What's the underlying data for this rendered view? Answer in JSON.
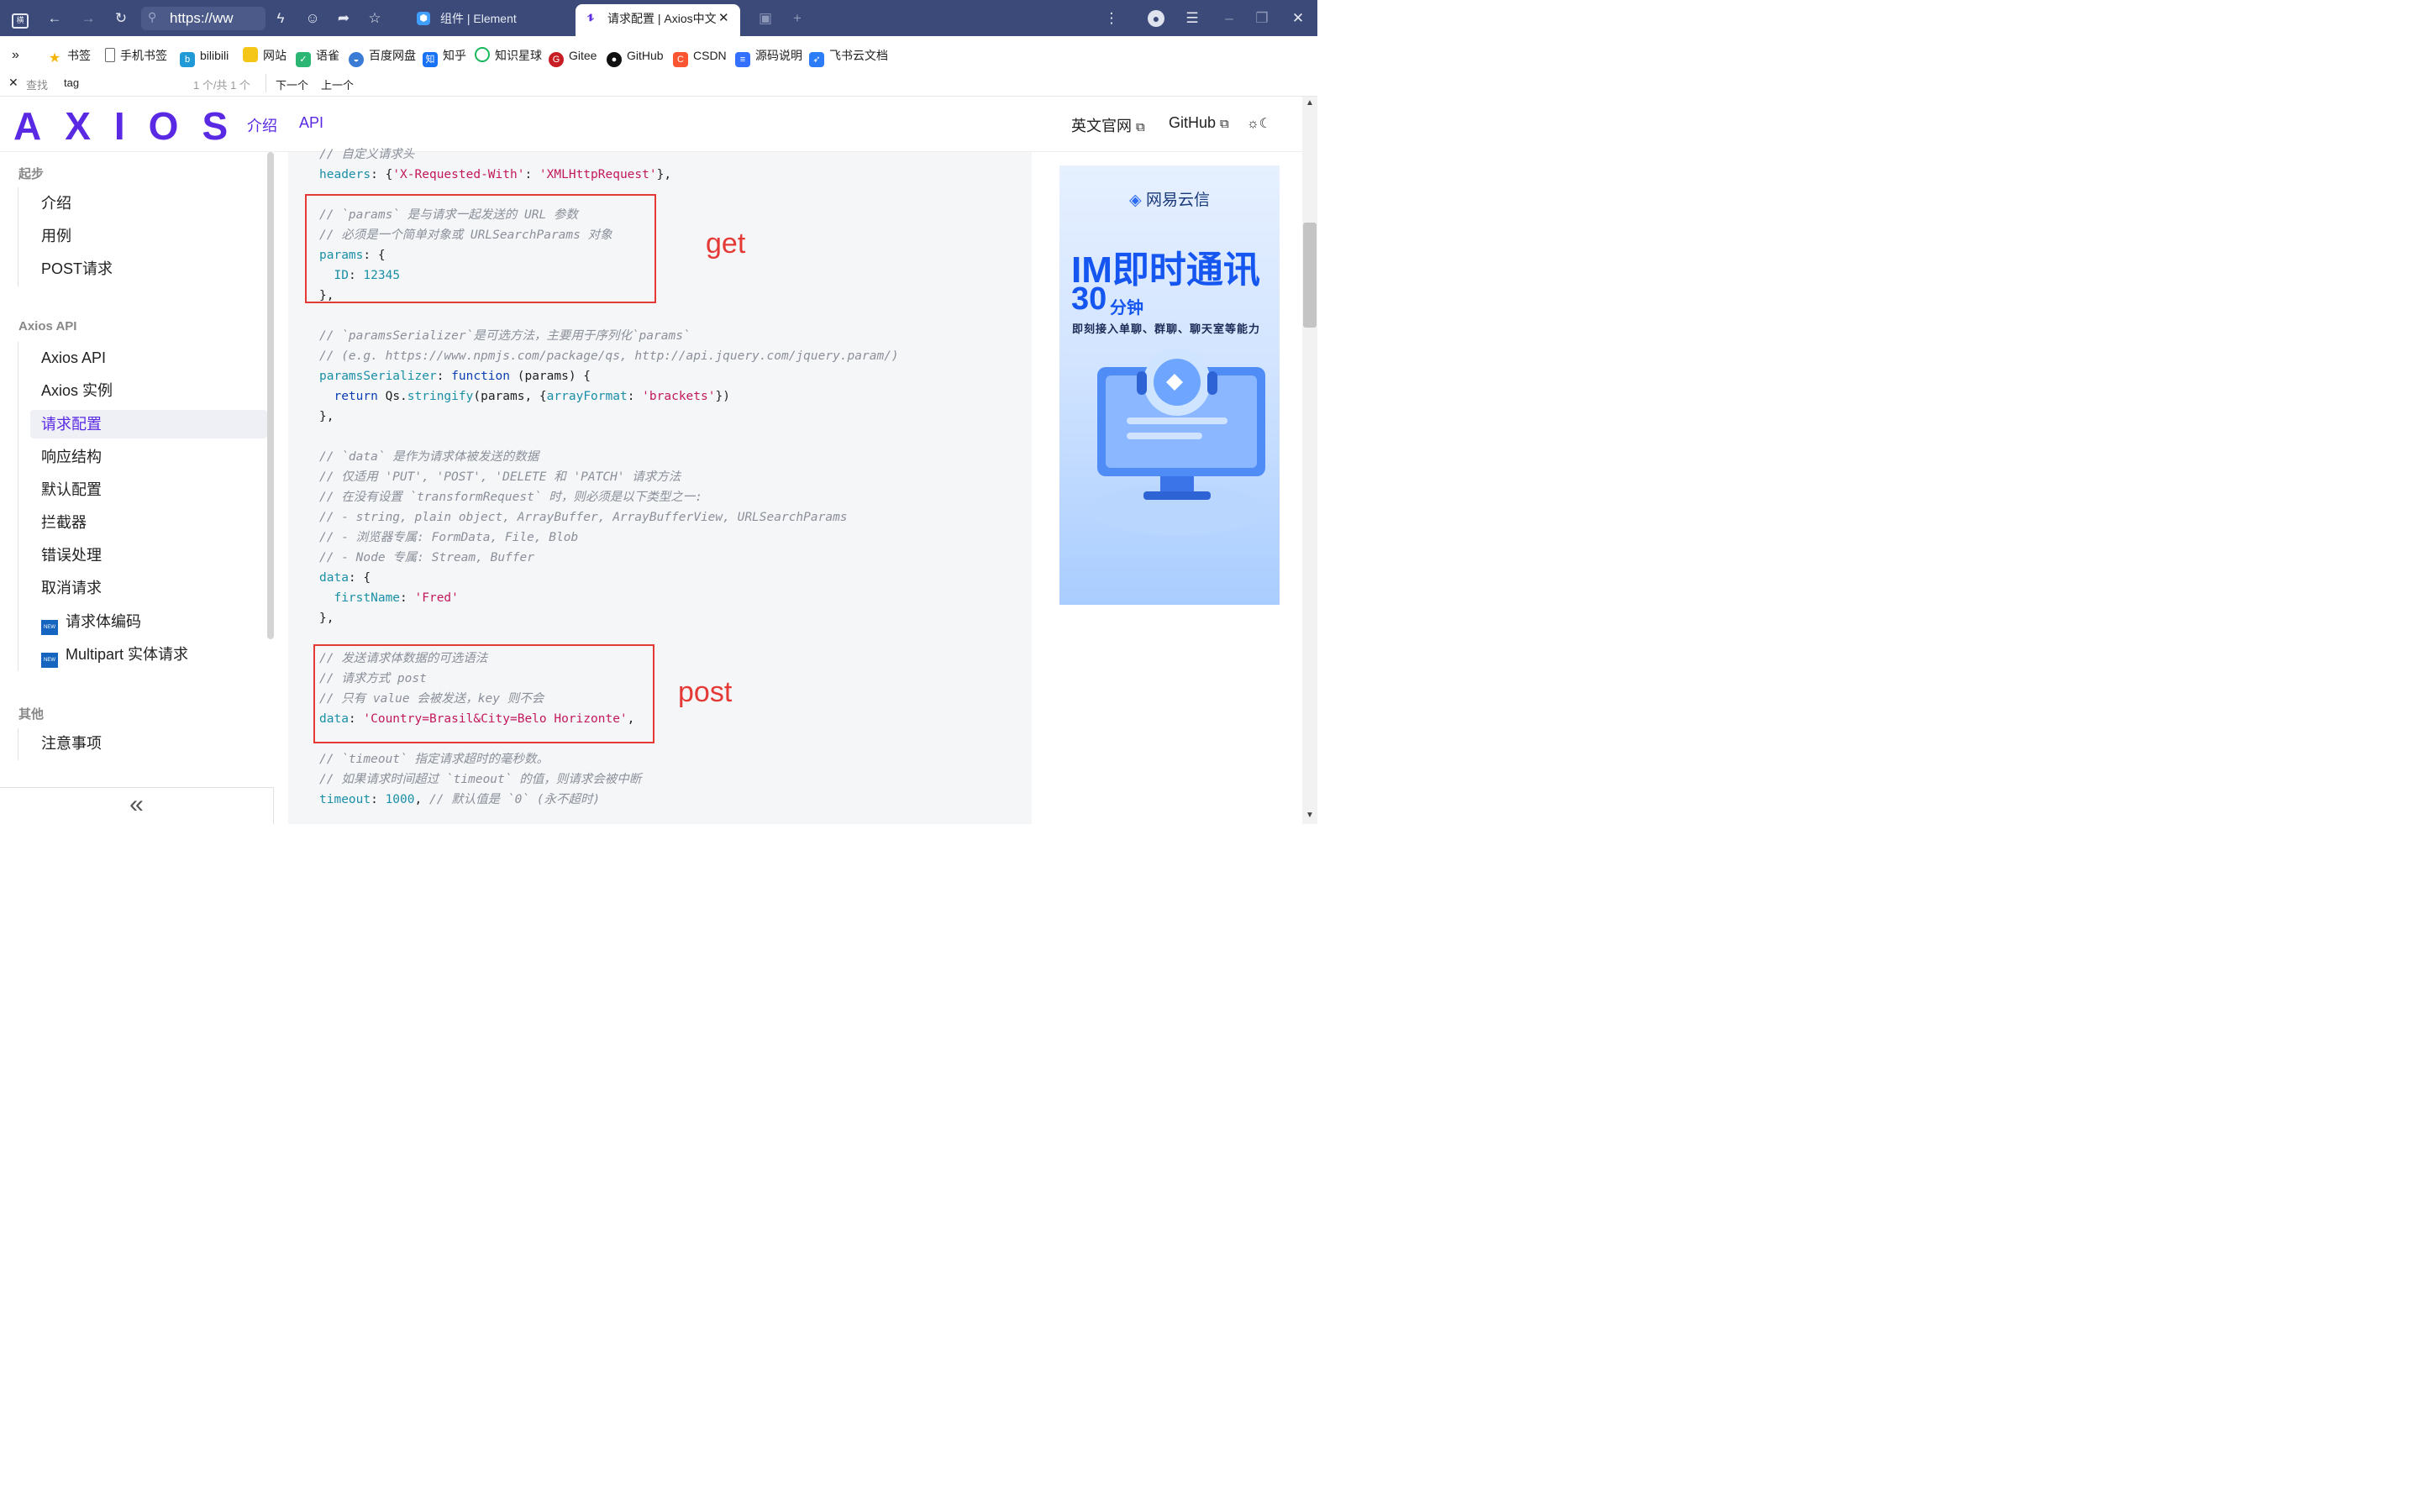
{
  "browser": {
    "address": "https://ww",
    "tabs": [
      {
        "title": "组件 | Element",
        "active": false
      },
      {
        "title": "请求配置 | Axios中文",
        "active": true
      }
    ]
  },
  "bookmarks": [
    {
      "label": "书签",
      "icon": "star-icon",
      "color": "#f5b400"
    },
    {
      "label": "手机书签",
      "icon": "phone-icon",
      "color": "#666666"
    },
    {
      "label": "bilibili",
      "icon": "bilibili-icon",
      "color": "#1f9ad6"
    },
    {
      "label": "网站",
      "icon": "folder-icon",
      "color": "#f5c518"
    },
    {
      "label": "语雀",
      "icon": "yuque-icon",
      "color": "#2bb673"
    },
    {
      "label": "百度网盘",
      "icon": "baidu-pan-icon",
      "color": "#3a7bd5"
    },
    {
      "label": "知乎",
      "icon": "zhihu-icon",
      "color": "#1772f6"
    },
    {
      "label": "知识星球",
      "icon": "planet-icon",
      "color": "#18b95c"
    },
    {
      "label": "Gitee",
      "icon": "gitee-icon",
      "color": "#c71d23"
    },
    {
      "label": "GitHub",
      "icon": "github-icon",
      "color": "#111111"
    },
    {
      "label": "CSDN",
      "icon": "csdn-icon",
      "color": "#fc5531"
    },
    {
      "label": "源码说明",
      "icon": "doc-icon",
      "color": "#3370ff"
    },
    {
      "label": "飞书云文档",
      "icon": "feishu-icon",
      "color": "#2b7cf6"
    }
  ],
  "findbar": {
    "label": "查找",
    "query": "tag",
    "count": "1 个/共 1 个",
    "next": "下一个",
    "prev": "上一个"
  },
  "header": {
    "logo": "AXIOS",
    "nav": [
      "介绍",
      "API"
    ],
    "english_site": "英文官网",
    "github": "GitHub"
  },
  "sidebar": {
    "sections": [
      {
        "title": "起步",
        "items": [
          "介绍",
          "用例",
          "POST请求"
        ]
      },
      {
        "title": "Axios API",
        "items": [
          "Axios API",
          "Axios 实例",
          "请求配置",
          "响应结构",
          "默认配置",
          "拦截器",
          "错误处理",
          "取消请求",
          "请求体编码",
          "Multipart 实体请求"
        ]
      },
      {
        "title": "其他",
        "items": [
          "注意事项"
        ]
      }
    ],
    "active_item": "请求配置",
    "new_badge": "NEW",
    "collapse_label": "«"
  },
  "code": {
    "lines": [
      [
        [
          "cm",
          "// 自定义请求头"
        ]
      ],
      [
        [
          "pr",
          "headers"
        ],
        [
          "t",
          ": {"
        ],
        [
          "st",
          "'X-Requested-With'"
        ],
        [
          "t",
          ": "
        ],
        [
          "st",
          "'XMLHttpRequest'"
        ],
        [
          "t",
          "},"
        ]
      ],
      [],
      [
        [
          "cm",
          "// `params` 是与请求一起发送的 URL 参数"
        ]
      ],
      [
        [
          "cm",
          "// 必须是一个简单对象或 URLSearchParams 对象"
        ]
      ],
      [
        [
          "pr",
          "params"
        ],
        [
          "t",
          ": {"
        ]
      ],
      [
        [
          "t",
          "  "
        ],
        [
          "pr",
          "ID"
        ],
        [
          "t",
          ": "
        ],
        [
          "nu",
          "12345"
        ]
      ],
      [
        [
          "t",
          "},"
        ]
      ],
      [],
      [
        [
          "cm",
          "// `paramsSerializer`是可选方法，主要用于序列化`params`"
        ]
      ],
      [
        [
          "cm",
          "// (e.g. https://www.npmjs.com/package/qs, http://api.jquery.com/jquery.param/)"
        ]
      ],
      [
        [
          "pr",
          "paramsSerializer"
        ],
        [
          "t",
          ": "
        ],
        [
          "kw",
          "function"
        ],
        [
          "t",
          " (params) {"
        ]
      ],
      [
        [
          "t",
          "  "
        ],
        [
          "kw",
          "return"
        ],
        [
          "t",
          " Qs."
        ],
        [
          "fn",
          "stringify"
        ],
        [
          "t",
          "(params, {"
        ],
        [
          "pr",
          "arrayFormat"
        ],
        [
          "t",
          ": "
        ],
        [
          "st",
          "'brackets'"
        ],
        [
          "t",
          "})"
        ]
      ],
      [
        [
          "t",
          "},"
        ]
      ],
      [],
      [
        [
          "cm",
          "// `data` 是作为请求体被发送的数据"
        ]
      ],
      [
        [
          "cm",
          "// 仅适用 'PUT', 'POST', 'DELETE 和 'PATCH' 请求方法"
        ]
      ],
      [
        [
          "cm",
          "// 在没有设置 `transformRequest` 时，则必须是以下类型之一:"
        ]
      ],
      [
        [
          "cm",
          "// - string, plain object, ArrayBuffer, ArrayBufferView, URLSearchParams"
        ]
      ],
      [
        [
          "cm",
          "// - 浏览器专属: FormData, File, Blob"
        ]
      ],
      [
        [
          "cm",
          "// - Node 专属: Stream, Buffer"
        ]
      ],
      [
        [
          "pr",
          "data"
        ],
        [
          "t",
          ": {"
        ]
      ],
      [
        [
          "t",
          "  "
        ],
        [
          "pr",
          "firstName"
        ],
        [
          "t",
          ": "
        ],
        [
          "st",
          "'Fred'"
        ]
      ],
      [
        [
          "t",
          "},"
        ]
      ],
      [],
      [
        [
          "cm",
          "// 发送请求体数据的可选语法"
        ]
      ],
      [
        [
          "cm",
          "// 请求方式 post"
        ]
      ],
      [
        [
          "cm",
          "// 只有 value 会被发送，key 则不会"
        ]
      ],
      [
        [
          "pr",
          "data"
        ],
        [
          "t",
          ": "
        ],
        [
          "st",
          "'Country=Brasil&City=Belo Horizonte'"
        ],
        [
          "t",
          ","
        ]
      ],
      [],
      [
        [
          "cm",
          "// `timeout` 指定请求超时的毫秒数。"
        ]
      ],
      [
        [
          "cm",
          "// 如果请求时间超过 `timeout` 的值，则请求会被中断"
        ]
      ],
      [
        [
          "pr",
          "timeout"
        ],
        [
          "t",
          ": "
        ],
        [
          "nu",
          "1000"
        ],
        [
          "t",
          ", "
        ],
        [
          "cm",
          "// 默认值是 `0` (永不超时)"
        ]
      ]
    ]
  },
  "annotations": {
    "get": "get",
    "post": "post",
    "color": "#e53935"
  },
  "ad": {
    "brand": "网易云信",
    "title": "IM即时通讯",
    "number": "30",
    "unit": "分钟",
    "subtitle": "即刻接入单聊、群聊、聊天室等能力"
  }
}
